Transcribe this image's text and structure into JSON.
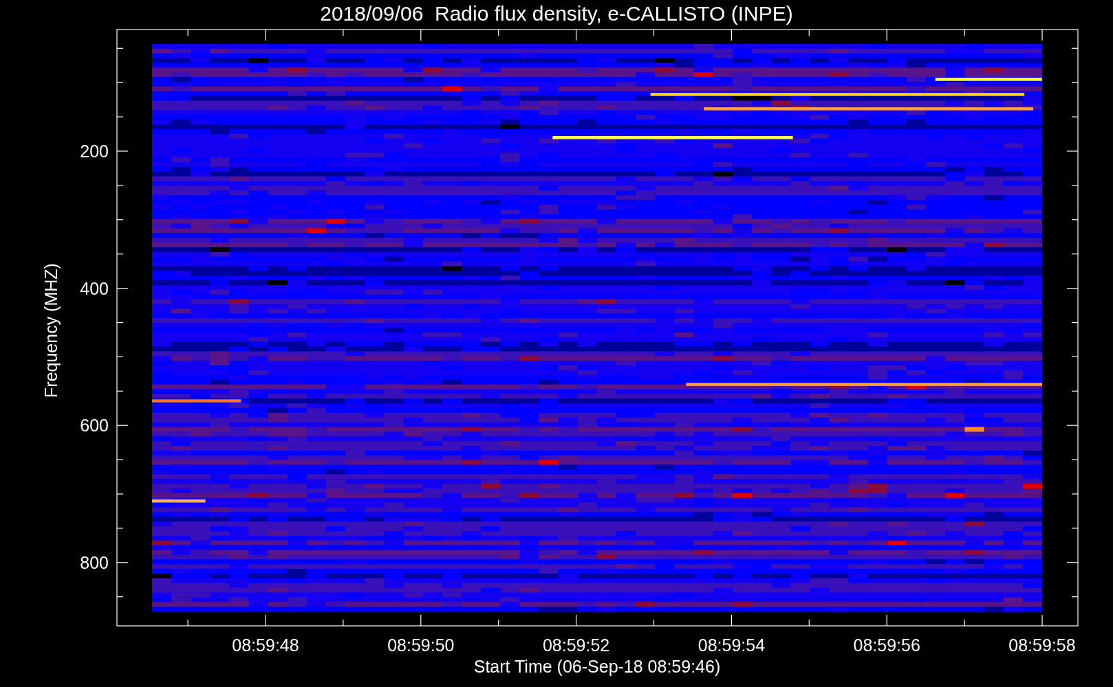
{
  "title": "2018/09/06  Radio flux density, e-CALLISTO (INPE)",
  "y_axis": {
    "label": "Frequency (MHZ)",
    "ticks": [
      "200",
      "400",
      "600",
      "800"
    ]
  },
  "x_axis": {
    "label": "Start Time (06-Sep-18 08:59:46)",
    "ticks": [
      "08:59:48",
      "08:59:50",
      "08:59:52",
      "08:59:54",
      "08:59:56",
      "08:59:58"
    ]
  }
}
